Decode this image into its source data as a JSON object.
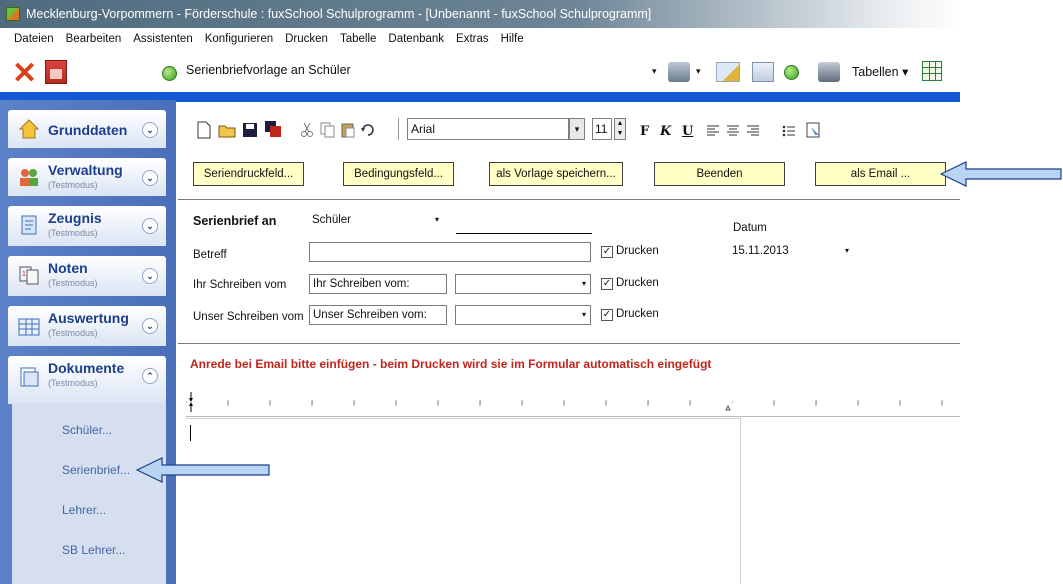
{
  "window": {
    "title": "Mecklenburg-Vorpommern - Förderschule : fuxSchool Schulprogramm - [Unbenannt - fuxSchool Schulprogramm]"
  },
  "menu": [
    "Dateien",
    "Bearbeiten",
    "Assistenten",
    "Konfigurieren",
    "Drucken",
    "Tabelle",
    "Datenbank",
    "Extras",
    "Hilfe"
  ],
  "toolbar": {
    "template_combo": "Serienbriefvorlage an Schüler",
    "tables_label": "Tabellen",
    "dropdown_glyph": "▾"
  },
  "sidebar": {
    "sections": [
      {
        "title": "Grunddaten",
        "subtitle": "",
        "chevron": "⌄"
      },
      {
        "title": "Verwaltung",
        "subtitle": "(Testmodus)",
        "chevron": "⌄"
      },
      {
        "title": "Zeugnis",
        "subtitle": "(Testmodus)",
        "chevron": "⌄"
      },
      {
        "title": "Noten",
        "subtitle": "(Testmodus)",
        "chevron": "⌄"
      },
      {
        "title": "Auswertung",
        "subtitle": "(Testmodus)",
        "chevron": "⌄"
      },
      {
        "title": "Dokumente",
        "subtitle": "(Testmodus)",
        "chevron": "⌃"
      }
    ],
    "documents": [
      "Schüler...",
      "Serienbrief...",
      "Lehrer...",
      "SB Lehrer..."
    ]
  },
  "format_bar": {
    "font": "Arial",
    "size": "11",
    "bold": "F",
    "italic": "K",
    "underline": "U"
  },
  "buttons": {
    "seriendruckfeld": "Seriendruckfeld...",
    "bedingungsfeld": "Bedingungsfeld...",
    "als_vorlage": "als Vorlage speichern...",
    "beenden": "Beenden",
    "als_email": "als Email ..."
  },
  "form": {
    "serienbrief_label": "Serienbrief an",
    "serienbrief_value": "Schüler",
    "betreff_label": "Betreff",
    "betreff_value": "",
    "ihr_schreiben_label": "Ihr Schreiben vom",
    "ihr_schreiben_value": "Ihr Schreiben vom:",
    "unser_schreiben_label": "Unser Schreiben vom",
    "unser_schreiben_value": "Unser Schreiben vom:",
    "drucken_label": "Drucken",
    "checkmark": "✓",
    "datum_label": "Datum",
    "datum_value": "15.11.2013"
  },
  "notice": "Anrede bei Email bitte einfügen - beim Drucken wird sie im Formular automatisch eingefügt",
  "colors": {
    "accent_blue": "#1558d6",
    "sidebar_blue": "#4a6fb8",
    "button_yellow": "#ffffc6",
    "notice_red": "#c0261c",
    "arrow_fill": "#b9d3f2"
  }
}
